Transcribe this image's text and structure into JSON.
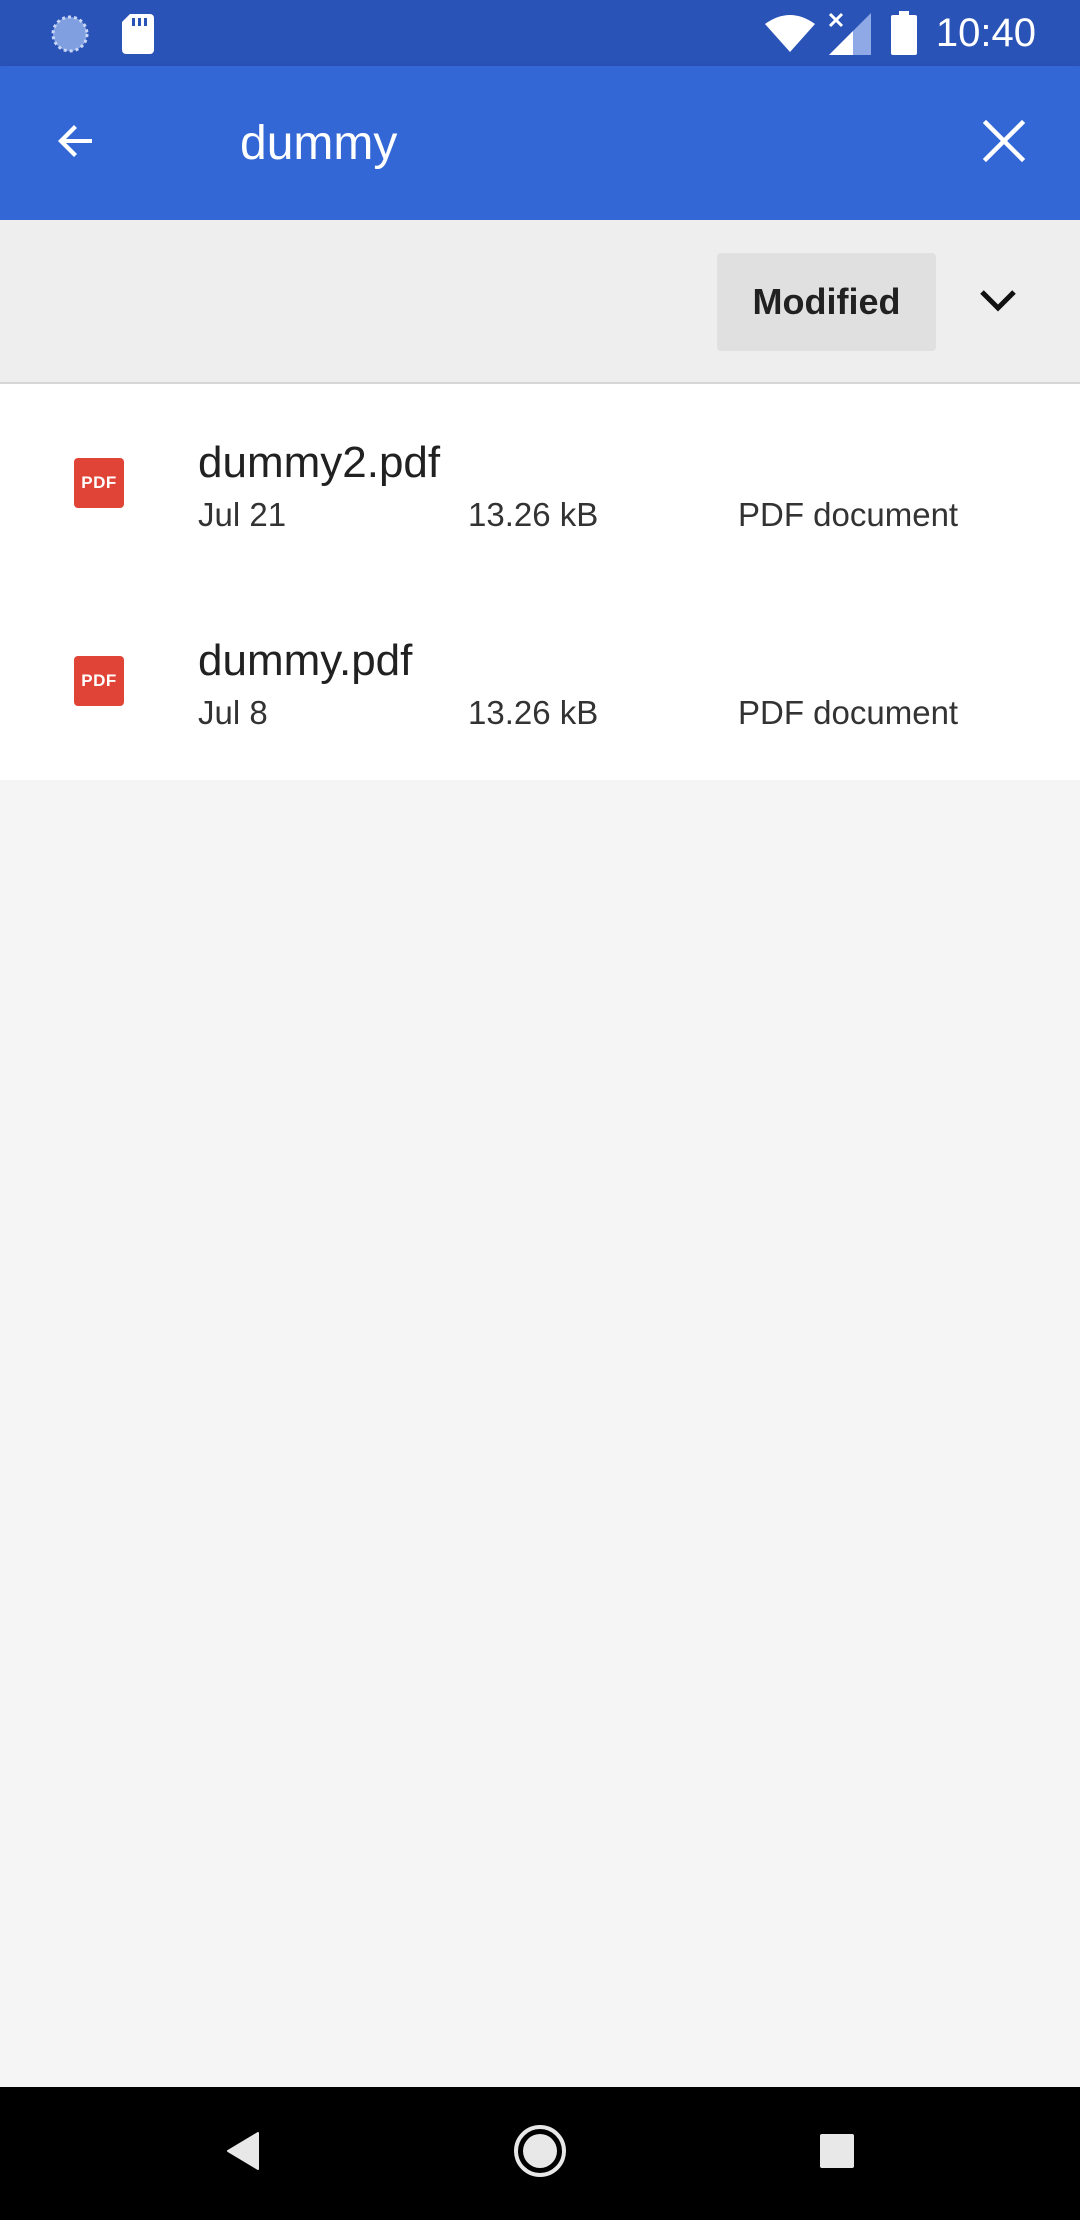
{
  "status_bar": {
    "time": "10:40",
    "icons": [
      "loading-spinner-icon",
      "sd-card-icon",
      "wifi-icon",
      "cell-signal-icon",
      "battery-icon"
    ]
  },
  "app_bar": {
    "back_icon": "arrow-back-icon",
    "search_query": "dummy",
    "clear_icon": "close-icon",
    "color": "#3367d6"
  },
  "sort_bar": {
    "sort_label": "Modified",
    "toggle_icon": "chevron-down-icon"
  },
  "files": [
    {
      "name": "dummy2.pdf",
      "date": "Jul 21",
      "size": "13.26 kB",
      "type": "PDF document",
      "icon_label": "PDF"
    },
    {
      "name": "dummy.pdf",
      "date": "Jul 8",
      "size": "13.26 kB",
      "type": "PDF document",
      "icon_label": "PDF"
    }
  ],
  "nav_bar": {
    "buttons": [
      "back-triangle-icon",
      "home-circle-icon",
      "recents-square-icon"
    ]
  },
  "colors": {
    "status_bar": "#2a53b8",
    "app_bar": "#3367d6",
    "pdf_icon": "#e04437"
  }
}
